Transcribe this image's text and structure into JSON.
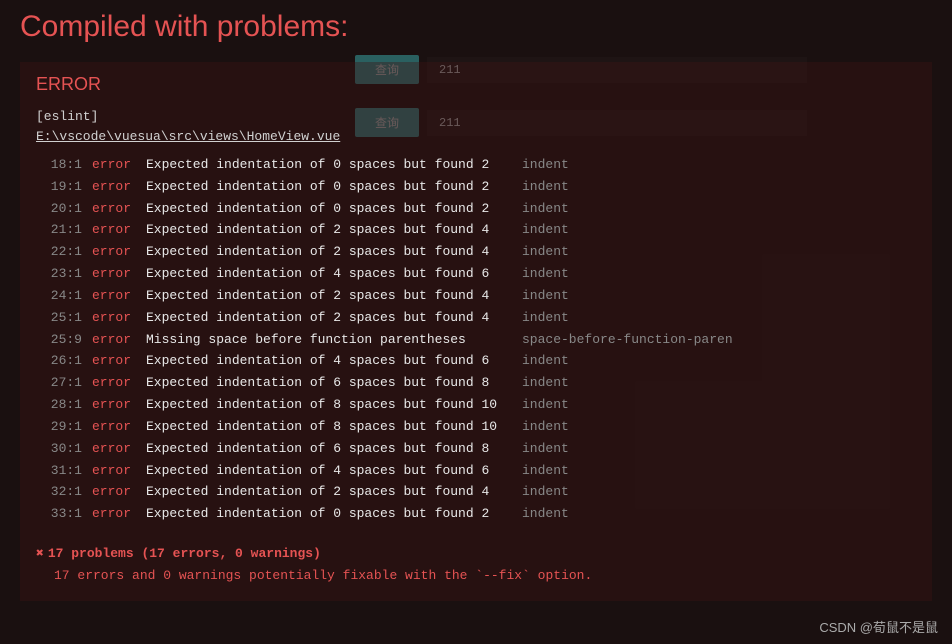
{
  "title": "Compiled with problems:",
  "background_elements": {
    "btn_label": "查询",
    "value": "211"
  },
  "panel": {
    "heading": "ERROR",
    "source": "[eslint]",
    "file": "E:\\vscode\\vuesua\\src\\views\\HomeView.vue",
    "errors": [
      {
        "linecol": "18:1",
        "severity": "error",
        "message": "Expected indentation of 0 spaces but found 2",
        "rule": "indent"
      },
      {
        "linecol": "19:1",
        "severity": "error",
        "message": "Expected indentation of 0 spaces but found 2",
        "rule": "indent"
      },
      {
        "linecol": "20:1",
        "severity": "error",
        "message": "Expected indentation of 0 spaces but found 2",
        "rule": "indent"
      },
      {
        "linecol": "21:1",
        "severity": "error",
        "message": "Expected indentation of 2 spaces but found 4",
        "rule": "indent"
      },
      {
        "linecol": "22:1",
        "severity": "error",
        "message": "Expected indentation of 2 spaces but found 4",
        "rule": "indent"
      },
      {
        "linecol": "23:1",
        "severity": "error",
        "message": "Expected indentation of 4 spaces but found 6",
        "rule": "indent"
      },
      {
        "linecol": "24:1",
        "severity": "error",
        "message": "Expected indentation of 2 spaces but found 4",
        "rule": "indent"
      },
      {
        "linecol": "25:1",
        "severity": "error",
        "message": "Expected indentation of 2 spaces but found 4",
        "rule": "indent"
      },
      {
        "linecol": "25:9",
        "severity": "error",
        "message": "Missing space before function parentheses",
        "rule": "space-before-function-paren"
      },
      {
        "linecol": "26:1",
        "severity": "error",
        "message": "Expected indentation of 4 spaces but found 6",
        "rule": "indent"
      },
      {
        "linecol": "27:1",
        "severity": "error",
        "message": "Expected indentation of 6 spaces but found 8",
        "rule": "indent"
      },
      {
        "linecol": "28:1",
        "severity": "error",
        "message": "Expected indentation of 8 spaces but found 10",
        "rule": "indent"
      },
      {
        "linecol": "29:1",
        "severity": "error",
        "message": "Expected indentation of 8 spaces but found 10",
        "rule": "indent"
      },
      {
        "linecol": "30:1",
        "severity": "error",
        "message": "Expected indentation of 6 spaces but found 8",
        "rule": "indent"
      },
      {
        "linecol": "31:1",
        "severity": "error",
        "message": "Expected indentation of 4 spaces but found 6",
        "rule": "indent"
      },
      {
        "linecol": "32:1",
        "severity": "error",
        "message": "Expected indentation of 2 spaces but found 4",
        "rule": "indent"
      },
      {
        "linecol": "33:1",
        "severity": "error",
        "message": "Expected indentation of 0 spaces but found 2",
        "rule": "indent"
      }
    ],
    "summary": {
      "line1": "17 problems (17 errors, 0 warnings)",
      "line2": "17 errors and 0 warnings potentially fixable with the `--fix` option."
    }
  },
  "watermark": "CSDN @荀鼠不是鼠"
}
